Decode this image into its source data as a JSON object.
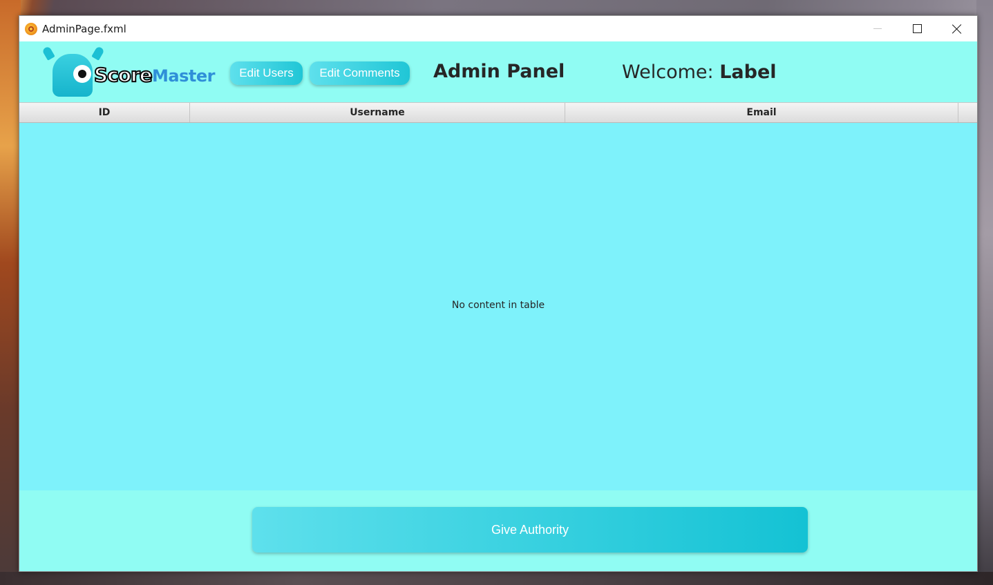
{
  "window": {
    "title": "AdminPage.fxml"
  },
  "header": {
    "logo_score": "Score",
    "logo_master": "Master",
    "edit_users_label": "Edit Users",
    "edit_comments_label": "Edit Comments",
    "panel_title": "Admin Panel",
    "welcome_prefix": "Welcome:",
    "welcome_name": "Label"
  },
  "table": {
    "columns": [
      "ID",
      "Username",
      "Email"
    ],
    "rows": [],
    "empty_message": "No content in table"
  },
  "footer": {
    "give_authority_label": "Give Authority"
  },
  "colors": {
    "background": "#8dfcf4",
    "table_body": "#7ef2fb",
    "button": "#20c6d6",
    "logo_blue": "#2f8fd8"
  },
  "icons": {
    "app": "java-app-icon",
    "minimize": "minimize-icon",
    "maximize": "maximize-icon",
    "close": "close-icon",
    "logo": "monster-logo-icon"
  }
}
